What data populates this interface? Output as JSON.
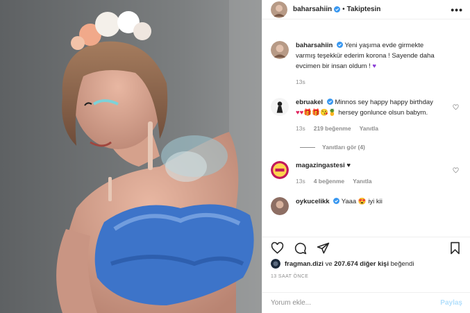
{
  "post": {
    "author": "baharsahiin",
    "follow_dot": "•",
    "follow_label": "Takiptesin",
    "more_label": "•••",
    "caption_username": "baharsahiin",
    "caption_text": "Yeni yaşıma evde girmekte varmış teşekkür ederim korona ! Sayende daha evcimen bir insan oldum !",
    "caption_emoji": "♥",
    "caption_time": "13s"
  },
  "comments": [
    {
      "username": "ebruakel",
      "text": "Minnos sey happy happy birthday",
      "emoji": "♥♥🎁🎁😘🍍",
      "text2": "hersey gonlunce olsun babym.",
      "time": "13s",
      "likes": "219 beğenme",
      "reply": "Yanıtla"
    },
    {
      "username": "magazingastesi",
      "text": "",
      "emoji": "♥",
      "time": "13s",
      "likes": "4 beğenme",
      "reply": "Yanıtla"
    },
    {
      "username": "oykucelikk",
      "text": "Yaaa",
      "emoji": "😍",
      "text2": "iyi kii"
    }
  ],
  "view_replies": "Yanıtları gör (4)",
  "likes_line": {
    "user": "fragman.dizi",
    "joiner": "ve",
    "others": "207.674 diğer kişi",
    "suffix": "beğendi"
  },
  "timestamp": "13 SAAT ÖNCE",
  "add_comment": {
    "placeholder": "Yorum ekle...",
    "post_label": "Paylaş"
  },
  "colors": {
    "verified": "#3897f0",
    "muted": "#8e8e8e",
    "post_disabled": "#b2dffc"
  },
  "icons": {
    "like": "heart-icon",
    "comment": "comment-icon",
    "share": "paper-plane-icon",
    "save": "bookmark-icon",
    "verified": "verified-badge-icon",
    "more": "more-options-icon"
  }
}
